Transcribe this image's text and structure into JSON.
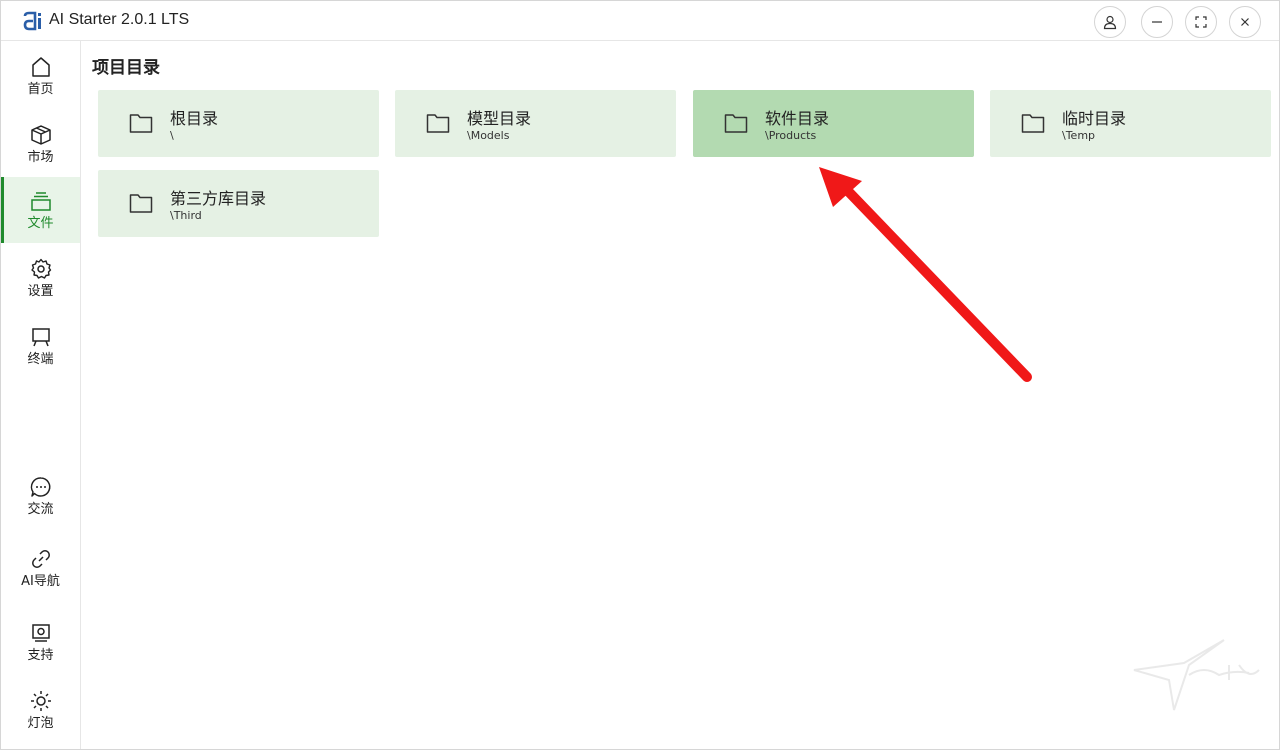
{
  "window": {
    "title": "AI Starter 2.0.1 LTS"
  },
  "titlebar_buttons": [
    {
      "icon": "user-icon"
    },
    {
      "icon": "minimize-icon"
    },
    {
      "icon": "maximize-icon"
    },
    {
      "icon": "close-icon"
    }
  ],
  "sidebar": {
    "items": [
      {
        "label": "首页",
        "icon": "home-icon"
      },
      {
        "label": "市场",
        "icon": "package-icon"
      },
      {
        "label": "文件",
        "icon": "files-icon",
        "active": true
      },
      {
        "label": "设置",
        "icon": "gear-icon"
      },
      {
        "label": "终端",
        "icon": "terminal-icon"
      }
    ],
    "bottom_items": [
      {
        "label": "交流",
        "icon": "chat-icon"
      },
      {
        "label": "AI导航",
        "icon": "link-icon"
      },
      {
        "label": "支持",
        "icon": "support-icon"
      },
      {
        "label": "灯泡",
        "icon": "sun-icon"
      }
    ]
  },
  "main": {
    "title": "项目目录",
    "folders": [
      {
        "name": "根目录",
        "path": "\\"
      },
      {
        "name": "模型目录",
        "path": "\\Models"
      },
      {
        "name": "软件目录",
        "path": "\\Products",
        "selected": true
      },
      {
        "name": "临时目录",
        "path": "\\Temp"
      },
      {
        "name": "第三方库目录",
        "path": "\\Third"
      }
    ]
  },
  "colors": {
    "accent": "#1f8a2c",
    "card_bg": "#e5f1e4",
    "card_selected_bg": "#b3dab1",
    "annotation_arrow": "#f01818"
  }
}
